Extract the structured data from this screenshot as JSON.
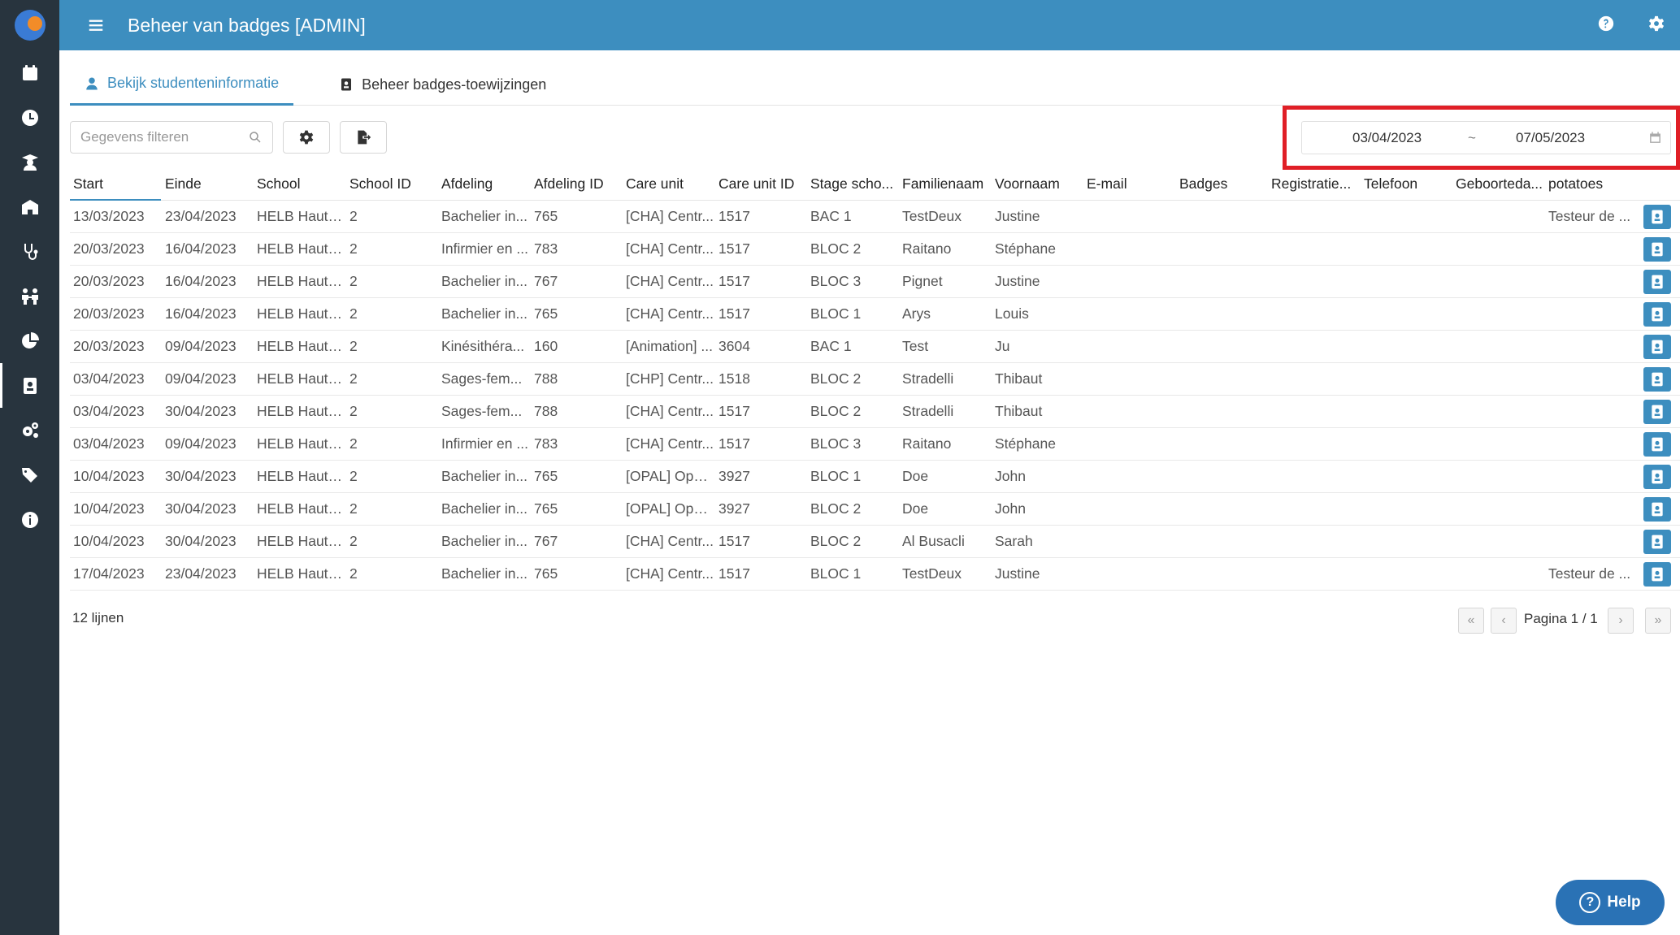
{
  "header": {
    "title": "Beheer van badges [ADMIN]"
  },
  "tabs": [
    {
      "label": "Bekijk studenteninformatie"
    },
    {
      "label": "Beheer badges-toewijzingen"
    }
  ],
  "filter": {
    "placeholder": "Gegevens filteren"
  },
  "date_range": {
    "start": "03/04/2023",
    "separator": "~",
    "end": "07/05/2023"
  },
  "table": {
    "columns": [
      "Start",
      "Einde",
      "School",
      "School ID",
      "Afdeling",
      "Afdeling ID",
      "Care unit",
      "Care unit ID",
      "Stage scho...",
      "Familienaam",
      "Voornaam",
      "E-mail",
      "Badges",
      "Registratie...",
      "Telefoon",
      "Geboorteda...",
      "potatoes"
    ],
    "rows": [
      [
        "13/03/2023",
        "23/04/2023",
        "HELB Haute...",
        "2",
        "Bachelier in...",
        "765",
        "[CHA] Centr...",
        "1517",
        "BAC 1",
        "TestDeux",
        "Justine",
        "",
        "",
        "",
        "",
        "",
        "Testeur de ..."
      ],
      [
        "20/03/2023",
        "16/04/2023",
        "HELB Haute...",
        "2",
        "Infirmier en ...",
        "783",
        "[CHA] Centr...",
        "1517",
        "BLOC 2",
        "Raitano",
        "Stéphane",
        "",
        "",
        "",
        "",
        "",
        ""
      ],
      [
        "20/03/2023",
        "16/04/2023",
        "HELB Haute...",
        "2",
        "Bachelier in...",
        "767",
        "[CHA] Centr...",
        "1517",
        "BLOC 3",
        "Pignet",
        "Justine",
        "",
        "",
        "",
        "",
        "",
        ""
      ],
      [
        "20/03/2023",
        "16/04/2023",
        "HELB Haute...",
        "2",
        "Bachelier in...",
        "765",
        "[CHA] Centr...",
        "1517",
        "BLOC 1",
        "Arys",
        "Louis",
        "",
        "",
        "",
        "",
        "",
        ""
      ],
      [
        "20/03/2023",
        "09/04/2023",
        "HELB Haute...",
        "2",
        "Kinésithéra...",
        "160",
        "[Animation] ...",
        "3604",
        "BAC 1",
        "Test",
        "Ju",
        "",
        "",
        "",
        "",
        "",
        ""
      ],
      [
        "03/04/2023",
        "09/04/2023",
        "HELB Haute...",
        "2",
        "Sages-fem...",
        "788",
        "[CHP] Centr...",
        "1518",
        "BLOC 2",
        "Stradelli",
        "Thibaut",
        "",
        "",
        "",
        "",
        "",
        ""
      ],
      [
        "03/04/2023",
        "30/04/2023",
        "HELB Haute...",
        "2",
        "Sages-fem...",
        "788",
        "[CHA] Centr...",
        "1517",
        "BLOC 2",
        "Stradelli",
        "Thibaut",
        "",
        "",
        "",
        "",
        "",
        ""
      ],
      [
        "03/04/2023",
        "09/04/2023",
        "HELB Haute...",
        "2",
        "Infirmier en ...",
        "783",
        "[CHA] Centr...",
        "1517",
        "BLOC 3",
        "Raitano",
        "Stéphane",
        "",
        "",
        "",
        "",
        "",
        ""
      ],
      [
        "10/04/2023",
        "30/04/2023",
        "HELB Haute...",
        "2",
        "Bachelier in...",
        "765",
        "[OPAL] Opal...",
        "3927",
        "BLOC 1",
        "Doe",
        "John",
        "",
        "",
        "",
        "",
        "",
        ""
      ],
      [
        "10/04/2023",
        "30/04/2023",
        "HELB Haute...",
        "2",
        "Bachelier in...",
        "765",
        "[OPAL] Opal...",
        "3927",
        "BLOC 2",
        "Doe",
        "John",
        "",
        "",
        "",
        "",
        "",
        ""
      ],
      [
        "10/04/2023",
        "30/04/2023",
        "HELB Haute...",
        "2",
        "Bachelier in...",
        "767",
        "[CHA] Centr...",
        "1517",
        "BLOC 2",
        "Al Busacli",
        "Sarah",
        "",
        "",
        "",
        "",
        "",
        ""
      ],
      [
        "17/04/2023",
        "23/04/2023",
        "HELB Haute...",
        "2",
        "Bachelier in...",
        "765",
        "[CHA] Centr...",
        "1517",
        "BLOC 1",
        "TestDeux",
        "Justine",
        "",
        "",
        "",
        "",
        "",
        "Testeur de ..."
      ]
    ]
  },
  "footer": {
    "row_count": "12 lijnen",
    "page_label": "Pagina 1 / 1",
    "first_glyph": "«",
    "prev_glyph": "‹",
    "next_glyph": "›",
    "last_glyph": "»"
  },
  "help": {
    "label": "Help",
    "glyph": "?"
  },
  "colors": {
    "header": "#3d8ebf",
    "sidebar": "#28343e",
    "highlight": "#e01f26",
    "help": "#2a72b5"
  },
  "sidebar_icons": [
    "calendar-icon",
    "clock-icon",
    "student-icon",
    "school-icon",
    "stethoscope-icon",
    "people-icon",
    "pie-chart-icon",
    "badge-icon",
    "cogs-icon",
    "tags-icon",
    "info-icon"
  ]
}
